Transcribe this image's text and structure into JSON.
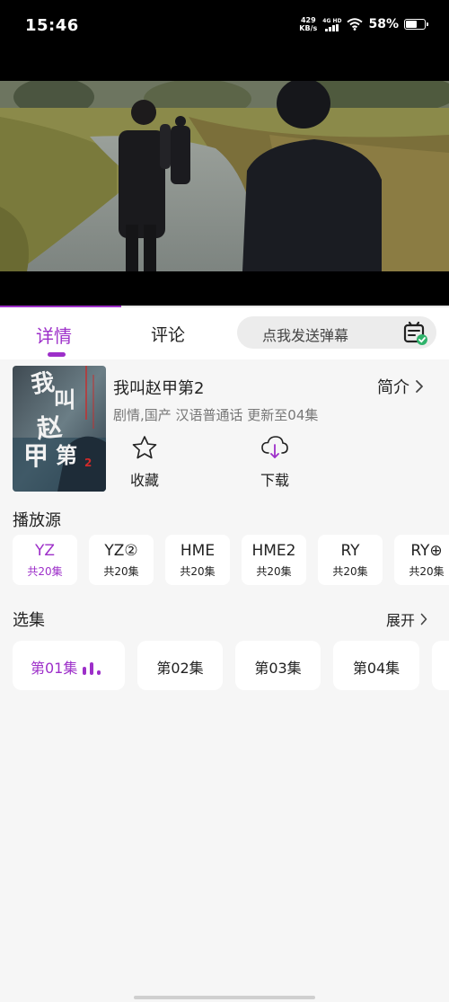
{
  "status_bar": {
    "time": "15:46",
    "net_speed_value": "429",
    "net_speed_unit": "KB/s",
    "network_label": "4G HD",
    "battery_percent": "58%",
    "battery_level": 0.58
  },
  "video": {
    "progress_fraction": 0.27
  },
  "tabs": {
    "details_label": "详情",
    "comments_label": "评论",
    "active": "详情"
  },
  "danmaku": {
    "placeholder": "点我发送弹幕"
  },
  "show": {
    "title": "我叫赵甲第2",
    "intro_label": "简介",
    "meta": "剧情,国产 汉语普通话 更新至04集",
    "poster_text": "我叫赵甲第2"
  },
  "actions": {
    "favorite_label": "收藏",
    "download_label": "下载"
  },
  "sources": {
    "title": "播放源",
    "items": [
      {
        "name": "YZ",
        "count": "共20集"
      },
      {
        "name": "YZ②",
        "count": "共20集"
      },
      {
        "name": "HME",
        "count": "共20集"
      },
      {
        "name": "HME2",
        "count": "共20集"
      },
      {
        "name": "RY",
        "count": "共20集"
      },
      {
        "name": "RY⊕",
        "count": "共20集"
      }
    ]
  },
  "episodes": {
    "title": "选集",
    "expand_label": "展开",
    "items": [
      {
        "label": "第01集"
      },
      {
        "label": "第02集"
      },
      {
        "label": "第03集"
      },
      {
        "label": "第04集"
      }
    ]
  },
  "colors": {
    "accent": "#9d2fc9",
    "background": "#f6f6f6",
    "card": "#ffffff"
  }
}
